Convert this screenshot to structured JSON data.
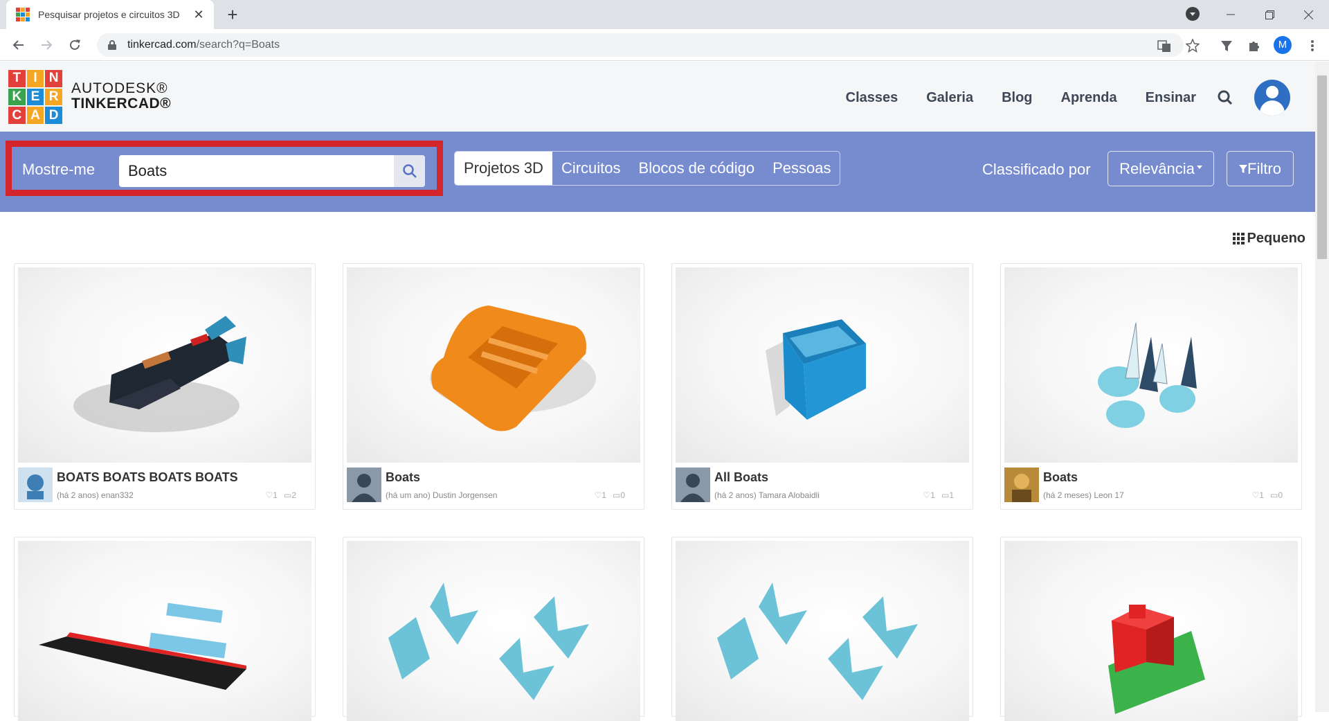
{
  "browser": {
    "tab_title": "Pesquisar projetos e circuitos 3D",
    "tab_close": "✕",
    "new_tab": "+",
    "url_host": "tinkercad.com",
    "url_path": "/search?q=Boats",
    "profile_initial": "M",
    "window_controls": [
      "—",
      "❐",
      "✕"
    ]
  },
  "header": {
    "logo_letters": [
      "T",
      "I",
      "N",
      "K",
      "E",
      "R",
      "C",
      "A",
      "D"
    ],
    "logo_colors": [
      "#e2403a",
      "#f5a623",
      "#e2403a",
      "#3aa34e",
      "#1c8bd8",
      "#f5a623",
      "#e2403a",
      "#f5a623",
      "#1c8bd8"
    ],
    "brand_line1": "AUTODESK®",
    "brand_line2": "TINKERCAD®",
    "nav": [
      "Classes",
      "Galeria",
      "Blog",
      "Aprenda",
      "Ensinar"
    ]
  },
  "search": {
    "label": "Mostre-me",
    "value": "Boats",
    "tabs": [
      {
        "label": "Projetos 3D",
        "active": true
      },
      {
        "label": "Circuitos",
        "active": false
      },
      {
        "label": "Blocos de código",
        "active": false
      },
      {
        "label": "Pessoas",
        "active": false
      }
    ],
    "sort_label": "Classificado por",
    "sort_value": "Relevância",
    "filter_label": "Filtro",
    "highlight_color": "#d4262a"
  },
  "view_toggle": "Pequeno",
  "results": [
    {
      "title": "BOATS BOATS BOATS BOATS",
      "sub": "(há 2 anos) enan332",
      "likes": "1",
      "comments": "2"
    },
    {
      "title": "Boats",
      "sub": "(há um ano) Dustin Jorgensen",
      "likes": "1",
      "comments": "0"
    },
    {
      "title": "All Boats",
      "sub": "(há 2 anos) Tamara Alobaidli",
      "likes": "1",
      "comments": "1"
    },
    {
      "title": "Boats",
      "sub": "(há 2 meses) Leon 17",
      "likes": "1",
      "comments": "0"
    },
    {
      "title": "",
      "sub": "",
      "likes": "",
      "comments": ""
    },
    {
      "title": "",
      "sub": "",
      "likes": "",
      "comments": ""
    },
    {
      "title": "",
      "sub": "",
      "likes": "",
      "comments": ""
    },
    {
      "title": "",
      "sub": "",
      "likes": "",
      "comments": ""
    }
  ],
  "colors": {
    "band": "#778bcf",
    "header_bg": "#f5f6f7",
    "nav_text": "#3d4756"
  }
}
